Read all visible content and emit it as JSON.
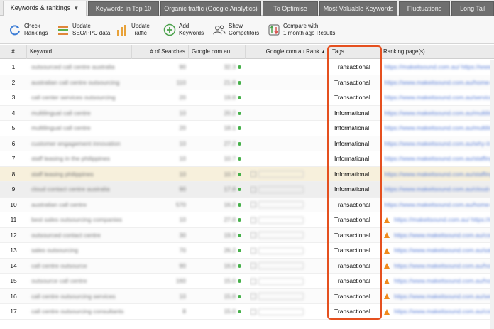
{
  "tabs": [
    {
      "label": "Keywords & rankings",
      "active": true
    },
    {
      "label": "Keywords in Top 10",
      "active": false
    },
    {
      "label": "Organic traffic (Google Analytics)",
      "active": false
    },
    {
      "label": "To Optimise",
      "active": false
    },
    {
      "label": "Most Valuable Keywords",
      "active": false
    },
    {
      "label": "Fluctuations",
      "active": false
    },
    {
      "label": "Long Tail",
      "active": false
    }
  ],
  "toolbar": {
    "check_rankings": "Check\nRankings",
    "update_seo": "Update\nSEO/PPC data",
    "update_traffic": "Update\nTraffic",
    "add_keywords": "Add\nKeywords",
    "show_competitors": "Show\nCompetitors",
    "compare": "Compare with\n1 month ago Results"
  },
  "columns": {
    "index": "#",
    "keyword": "Keyword",
    "searches": "# of Searches",
    "google": "Google.com.au ...",
    "google_rank": "Google.com.au Rank",
    "tags": "Tags",
    "ranking_pages": "Ranking page(s)"
  },
  "rows": [
    {
      "n": "1",
      "keyword": "outsourced call centre australia",
      "searches": "90",
      "kei": "32.3",
      "tag": "Transactional",
      "page": "https://makeitsound.com.au/ https://www"
    },
    {
      "n": "2",
      "keyword": "australian call centre outsourcing",
      "searches": "110",
      "kei": "21.8",
      "tag": "Transactional",
      "page": "https://www.makeitsound.com.au/home-b"
    },
    {
      "n": "3",
      "keyword": "call center services outsourcing",
      "searches": "20",
      "kei": "19.8",
      "tag": "Transactional",
      "page": "https://www.makeitsound.com.au/services"
    },
    {
      "n": "4",
      "keyword": "multilingual call centre",
      "searches": "10",
      "kei": "20.2",
      "tag": "Informational",
      "page": "https://www.makeitsound.com.au/multiling"
    },
    {
      "n": "5",
      "keyword": "multilingual call centre",
      "searches": "20",
      "kei": "18.1",
      "tag": "Informational",
      "page": "https://www.makeitsound.com.au/multiling"
    },
    {
      "n": "6",
      "keyword": "customer engagement innovation",
      "searches": "10",
      "kei": "27.2",
      "tag": "Informational",
      "page": "https://www.makeitsound.com.au/why-it-"
    },
    {
      "n": "7",
      "keyword": "staff leasing in the philippines",
      "searches": "10",
      "kei": "10.7",
      "tag": "Informational",
      "page": "https://www.makeitsound.com.au/staffing"
    },
    {
      "n": "8",
      "keyword": "staff leasing philippines",
      "searches": "10",
      "kei": "10.7",
      "tag": "Informational",
      "page": "https://www.makeitsound.com.au/staffing"
    },
    {
      "n": "9",
      "keyword": "cloud contact centre australia",
      "searches": "90",
      "kei": "17.8",
      "tag": "Informational",
      "page": "https://www.makeitsound.com.au/cloud-c"
    },
    {
      "n": "10",
      "keyword": "australian call centre",
      "searches": "570",
      "kei": "16.2",
      "tag": "Transactional",
      "page": "https://www.makeitsound.com.au/home-b"
    },
    {
      "n": "11",
      "keyword": "best sales outsourcing companies",
      "searches": "10",
      "kei": "27.8",
      "tag": "Transactional",
      "page": "https://makeitsound.com.au/ https://www",
      "warn": true
    },
    {
      "n": "12",
      "keyword": "outsourced contact centre",
      "searches": "30",
      "kei": "19.3",
      "tag": "Transactional",
      "page": "https://www.makeitsound.com.au/conta",
      "warn": true
    },
    {
      "n": "13",
      "keyword": "sales outsourcing",
      "searches": "70",
      "kei": "26.2",
      "tag": "Transactional",
      "page": "https://www.makeitsound.com.au/sales-o",
      "warn": true
    },
    {
      "n": "14",
      "keyword": "call centre outsource",
      "searches": "90",
      "kei": "16.8",
      "tag": "Transactional",
      "page": "https://www.makeitsound.com.au/home-b",
      "warn": true
    },
    {
      "n": "15",
      "keyword": "outsource call centre",
      "searches": "160",
      "kei": "15.0",
      "tag": "Transactional",
      "page": "https://www.makeitsound.com.au/home-b",
      "warn": true
    },
    {
      "n": "16",
      "keyword": "call centre outsourcing services",
      "searches": "10",
      "kei": "15.8",
      "tag": "Transactional",
      "page": "https://www.makeitsound.com.au/service",
      "warn": true
    },
    {
      "n": "17",
      "keyword": "call centre outsourcing consultants",
      "searches": "8",
      "kei": "15.0",
      "tag": "Transactional",
      "page": "https://www.makeitsound.com.au/consult",
      "warn": true
    }
  ],
  "colors": {
    "tag_frame": "#e5501f",
    "rank_dot": "#46b04a",
    "warning": "#f08a1c"
  }
}
